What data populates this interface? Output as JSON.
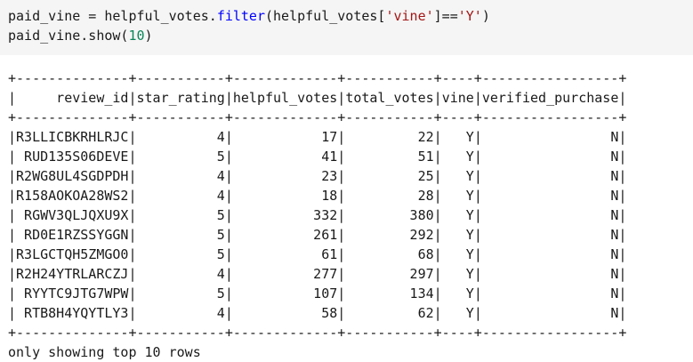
{
  "code": {
    "line1": {
      "var": "paid_vine",
      "assign": " = ",
      "obj": "helpful_votes.",
      "fn": "filter",
      "open": "(helpful_votes[",
      "key": "'vine'",
      "cmp": "]==",
      "val": "'Y'",
      "close": ")"
    },
    "line2": {
      "prefix": "paid_vine.show(",
      "num": "10",
      "suffix": ")"
    }
  },
  "table": {
    "columns": [
      "review_id",
      "star_rating",
      "helpful_votes",
      "total_votes",
      "vine",
      "verified_purchase"
    ],
    "rows": [
      [
        "R3LLICBKRHLRJC",
        "4",
        "17",
        "22",
        "Y",
        "N"
      ],
      [
        "RUD135S06DEVE",
        "5",
        "41",
        "51",
        "Y",
        "N"
      ],
      [
        "R2WG8UL4SGDPDH",
        "4",
        "23",
        "25",
        "Y",
        "N"
      ],
      [
        "R158AOKOA28WS2",
        "4",
        "18",
        "28",
        "Y",
        "N"
      ],
      [
        "RGWV3QLJQXU9X",
        "5",
        "332",
        "380",
        "Y",
        "N"
      ],
      [
        "RD0E1RZSSYGGN",
        "5",
        "261",
        "292",
        "Y",
        "N"
      ],
      [
        "R3LGCTQH5ZMGO0",
        "5",
        "61",
        "68",
        "Y",
        "N"
      ],
      [
        "R2H24YTRLARCZJ",
        "4",
        "277",
        "297",
        "Y",
        "N"
      ],
      [
        "RYYTC9JTG7WPW",
        "5",
        "107",
        "134",
        "Y",
        "N"
      ],
      [
        "RTB8H4YQYTLY3",
        "4",
        "58",
        "62",
        "Y",
        "N"
      ]
    ]
  },
  "footer": "only showing top 10 rows"
}
